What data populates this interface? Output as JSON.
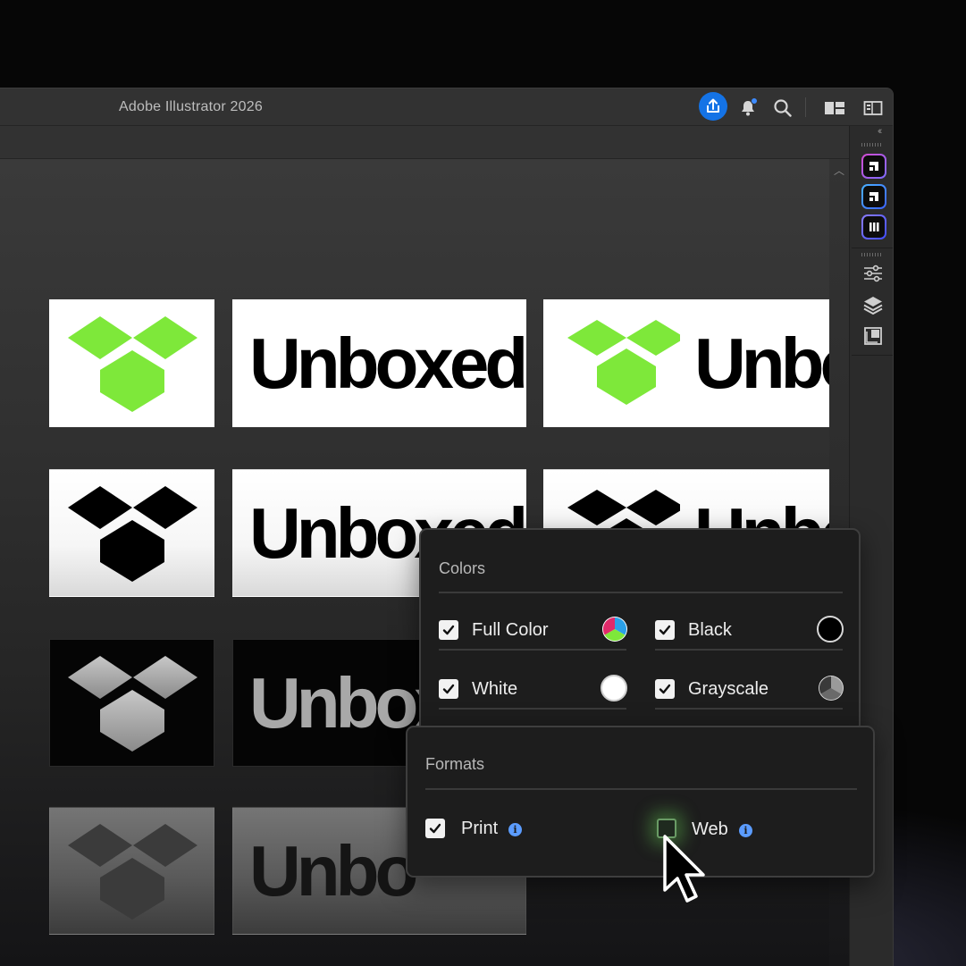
{
  "app": {
    "title": "Adobe Illustrator 2026"
  },
  "titlebar": {
    "icons": [
      "share-icon",
      "bell-icon",
      "search-icon",
      "workspace-layout-icon",
      "panel-toggle-icon"
    ],
    "share_color": "#1473e6",
    "notification_dot_color": "#3d8bff"
  },
  "right_panel": {
    "collapse_glyph": "‹‹",
    "plugins": [
      {
        "name": "plugin-1-icon",
        "gradient": [
          "#d44bd0",
          "#7d6cff"
        ]
      },
      {
        "name": "plugin-2-icon",
        "gradient": [
          "#4ab2ff",
          "#3c62ff"
        ]
      },
      {
        "name": "plugin-3-icon",
        "gradient": [
          "#8c7dff",
          "#3f4cff"
        ]
      }
    ],
    "tools": [
      "properties-icon",
      "layers-icon",
      "artboards-icon"
    ]
  },
  "canvas": {
    "brand_word": "Unboxed",
    "brand_word_cropped_2": "Unbo",
    "brand_word_cropped_3": "Unbox",
    "brand_word_cropped_4": "Unbo",
    "rows": [
      {
        "variant": "full-color",
        "tile_bg": "#ffffff",
        "mark_color": "#7ee83a",
        "word_color": "#000000"
      },
      {
        "variant": "black",
        "tile_bg": "#f4f4f4",
        "mark_color": "#000000",
        "word_color": "#000000"
      },
      {
        "variant": "white",
        "tile_bg": "#050505",
        "mark_color": "#a8a8a8",
        "word_color": "#a8a8a8"
      },
      {
        "variant": "grayscale",
        "tile_bg": "#6a6a6a",
        "mark_color": "#333333",
        "word_color": "#111111"
      }
    ]
  },
  "colors_popup": {
    "title": "Colors",
    "options": [
      {
        "label": "Full Color",
        "checked": true,
        "swatch": "tricolor"
      },
      {
        "label": "Black",
        "checked": true,
        "swatch": "#000000"
      },
      {
        "label": "White",
        "checked": true,
        "swatch": "#ffffff"
      },
      {
        "label": "Grayscale",
        "checked": true,
        "swatch": "gray-tricolor"
      }
    ]
  },
  "formats_popup": {
    "title": "Formats",
    "options": [
      {
        "label": "Print",
        "checked": true,
        "info": "info-icon"
      },
      {
        "label": "Web",
        "checked": false,
        "info": "info-icon",
        "hovered": true
      }
    ],
    "info_color": "#5b9cff",
    "hover_glow_color": "#6edc5a"
  }
}
